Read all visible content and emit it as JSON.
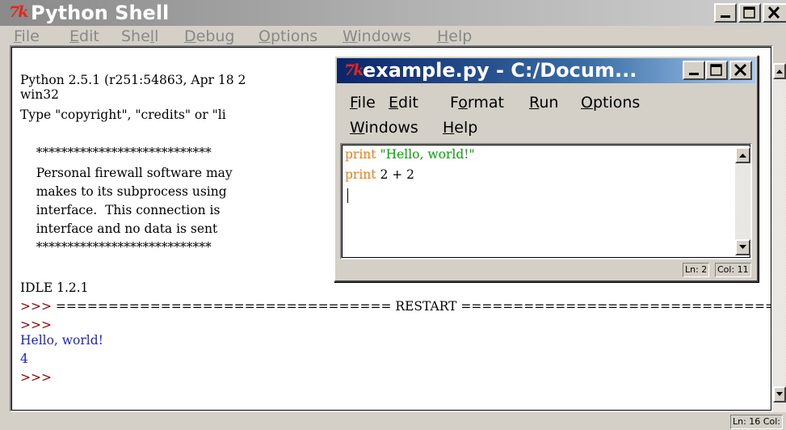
{
  "shell": {
    "logo": "7k",
    "title": "Python Shell",
    "menu": [
      {
        "pre": "",
        "u": "F",
        "post": "ile"
      },
      {
        "pre": "",
        "u": "E",
        "post": "dit"
      },
      {
        "pre": "She",
        "u": "l",
        "post": "l"
      },
      {
        "pre": "",
        "u": "D",
        "post": "ebug"
      },
      {
        "pre": "",
        "u": "O",
        "post": "ptions"
      },
      {
        "pre": "",
        "u": "W",
        "post": "indows"
      },
      {
        "pre": "",
        "u": "H",
        "post": "elp"
      }
    ],
    "lines": {
      "l1": "Python 2.5.1 (r251:54863, Apr 18 2",
      "l2": "win32",
      "l3": "Type \"copyright\", \"credits\" or \"li",
      "l4": "    ****************************",
      "l5": "    Personal firewall software may",
      "l6": "    makes to its subprocess using",
      "l7": "    interface.  This connection is",
      "l8": "    interface and no data is sent",
      "l9": "    ****************************",
      "l10": "IDLE 1.2.1",
      "l11_prompt": ">>> ",
      "l11_rest": "================================ RESTART ================================",
      "l12": ">>>",
      "l13": "Hello, world!",
      "l14": "4",
      "l15": ">>>"
    },
    "status": "Ln: 16 Col:"
  },
  "editor": {
    "logo": "7k",
    "title": "example.py - C:/Docum...",
    "menu_row1": [
      {
        "pre": "",
        "u": "F",
        "post": "ile"
      },
      {
        "pre": "",
        "u": "E",
        "post": "dit"
      },
      {
        "pre": "F",
        "u": "o",
        "post": "rmat"
      },
      {
        "pre": "",
        "u": "R",
        "post": "un"
      },
      {
        "pre": "",
        "u": "O",
        "post": "ptions"
      }
    ],
    "menu_row2": [
      {
        "pre": "",
        "u": "W",
        "post": "indows"
      },
      {
        "pre": "",
        "u": "H",
        "post": "elp"
      }
    ],
    "code": {
      "line1_kw": "print",
      "line1_str": " \"Hello, world!\"",
      "line2_kw": "print",
      "line2_rest": " 2 + 2"
    },
    "status_ln": "Ln: 2",
    "status_col": "Col: 11"
  }
}
